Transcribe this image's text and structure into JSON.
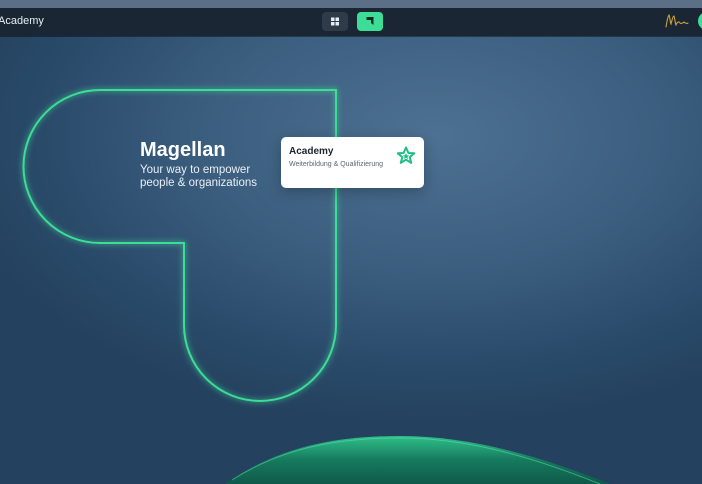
{
  "header": {
    "app_title": "Academy",
    "nav_icons": [
      "dashboard-grid-icon",
      "flag-icon"
    ],
    "signature_icon": "signature-icon"
  },
  "hero": {
    "title": "Magellan",
    "subtitle_line1": "Your way to empower",
    "subtitle_line2": "people & organizations"
  },
  "card": {
    "title": "Academy",
    "subtitle": "Weiterbildung & Qualifizierung",
    "icon": "star-icon"
  },
  "colors": {
    "accent": "#3ddc97",
    "topbar": "#1a2633",
    "background": "#3c5f80"
  }
}
